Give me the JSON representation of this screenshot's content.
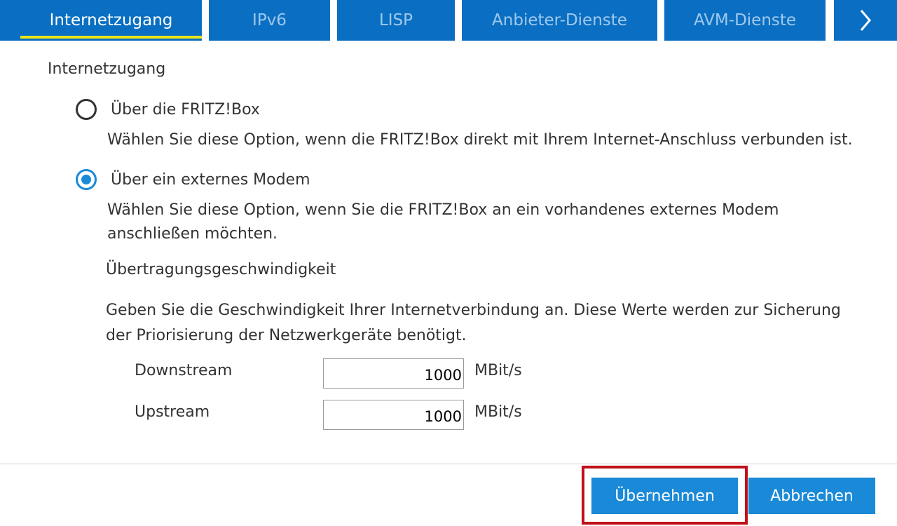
{
  "tabs": [
    {
      "label": "Internetzugang",
      "active": true
    },
    {
      "label": "IPv6",
      "active": false
    },
    {
      "label": "LISP",
      "active": false
    },
    {
      "label": "Anbieter-Dienste",
      "active": false
    },
    {
      "label": "AVM-Dienste",
      "active": false
    }
  ],
  "section_title": "Internetzugang",
  "options": [
    {
      "label": "Über die FRITZ!Box",
      "description": "Wählen Sie diese Option, wenn die FRITZ!Box direkt mit Ihrem Internet-Anschluss verbunden ist.",
      "checked": false
    },
    {
      "label": "Über ein externes Modem",
      "description_line1": "Wählen Sie diese Option, wenn Sie die FRITZ!Box an ein vorhandenes externes Modem",
      "description_line2": "anschließen möchten.",
      "checked": true
    }
  ],
  "speed": {
    "title": "Übertragungsgeschwindigkeit",
    "description_line1": "Geben Sie die Geschwindigkeit Ihrer Internetverbindung an. Diese Werte werden zur Sicherung",
    "description_line2": "der Priorisierung der Netzwerkgeräte benötigt.",
    "downstream_label": "Downstream",
    "downstream_value": "1000",
    "upstream_label": "Upstream",
    "upstream_value": "1000",
    "unit": "MBit/s"
  },
  "buttons": {
    "apply": "Übernehmen",
    "cancel": "Abbrechen"
  },
  "colors": {
    "tab_bg": "#0a6fc2",
    "active_underline": "#e8e31a",
    "button_bg": "#1a8ad8",
    "highlight_border": "#c0101a"
  }
}
